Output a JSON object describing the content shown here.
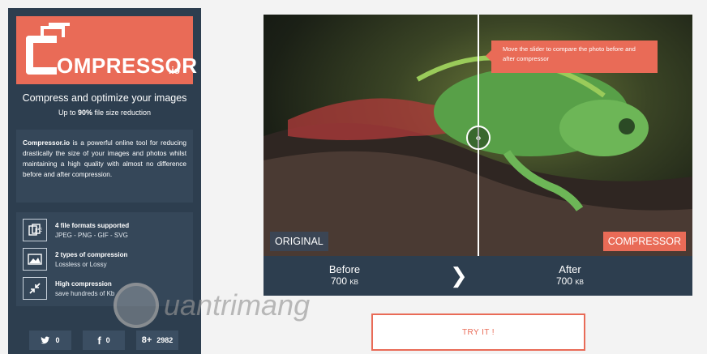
{
  "sidebar": {
    "logo_text": "OMPRESSOR",
    "logo_suffix": ".io",
    "tagline": "Compress and optimize your images",
    "subtag_prefix": "Up to ",
    "subtag_bold": "90%",
    "subtag_suffix": " file size reduction",
    "description_bold": "Compressor.io",
    "description": " is a powerful online tool for reducing drastically the size of your images and photos whilst maintaining a high quality with almost no difference before and after compression.",
    "features": [
      {
        "title": "4 file formats supported",
        "detail": "JPEG - PNG - GIF - SVG",
        "icon": "file-formats-icon"
      },
      {
        "title": "2 types of compression",
        "detail": "Lossless or Lossy",
        "icon": "image-icon"
      },
      {
        "title": "High compression",
        "detail": "save hundreds of Kb",
        "icon": "compress-arrows-icon"
      }
    ],
    "social": [
      {
        "icon_glyph": "🐦",
        "count": "0"
      },
      {
        "icon_glyph": "f",
        "count": "0"
      },
      {
        "icon_glyph": "8+",
        "count": "2982"
      }
    ]
  },
  "compare": {
    "tooltip": "Move the slider to compare the photo before and after compressor",
    "label_original": "ORIGINAL",
    "label_compressor": "COMPRESSOR",
    "before_label": "Before",
    "before_size": "700",
    "before_unit": "KB",
    "after_label": "After",
    "after_size": "700",
    "after_unit": "KB"
  },
  "cta": {
    "label": "TRY IT !"
  },
  "watermark": {
    "text": "uantrimang"
  },
  "colors": {
    "accent": "#e96b57",
    "sidebar": "#2d3e4f",
    "panel": "#354759"
  }
}
